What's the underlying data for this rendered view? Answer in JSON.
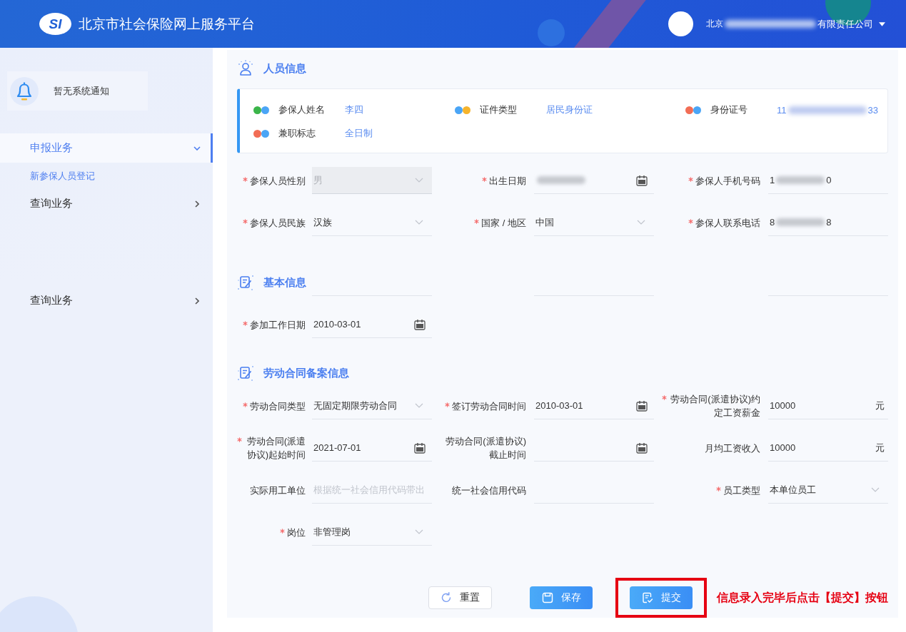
{
  "header": {
    "logo_text": "SI",
    "title": "北京市社会保险网上服务平台",
    "account": {
      "name_start": "北京",
      "name_end": "有限责任公司",
      "redacted": true
    }
  },
  "sidebar": {
    "notice": "暂无系统通知",
    "menu_groups": [
      {
        "items": [
          {
            "label": "申报业务",
            "selected": true,
            "expanded": true,
            "children": [
              {
                "label": "新参保人员登记",
                "selected": true
              }
            ]
          },
          {
            "label": "查询业务",
            "selected": false,
            "expanded": false
          }
        ]
      },
      {
        "items": [
          {
            "label": "查询业务",
            "selected": false,
            "expanded": false
          }
        ]
      }
    ]
  },
  "sections": [
    {
      "kind": "summary",
      "title": "人员信息",
      "summary": [
        {
          "label": "参保人姓名",
          "value": "李四",
          "redacted": false,
          "dots": [
            {
              "color": "#3bb54a"
            },
            {
              "color": "#4aa5f6"
            }
          ]
        },
        {
          "label": "证件类型",
          "value": "居民身份证",
          "redacted": false,
          "dots": [
            {
              "color": "#4aa5f6"
            },
            {
              "color": "#f6b42c"
            }
          ]
        },
        {
          "label": "身份证号",
          "value": "11",
          "value_tail": "33",
          "redacted": true,
          "dots": [
            {
              "color": "#f26d55"
            },
            {
              "color": "#4aa5f6"
            }
          ]
        },
        {
          "label": "兼职标志",
          "value": "全日制",
          "redacted": false,
          "dots": [
            {
              "color": "#f26d55"
            },
            {
              "color": "#4aa5f6"
            }
          ]
        }
      ],
      "fields": [
        {
          "kind": "select",
          "label": "参保人员性别",
          "required": true,
          "value": "男",
          "disabled": true,
          "redacted": false
        },
        {
          "kind": "date",
          "label": "出生日期",
          "required": true,
          "disabled": false,
          "redacted": true
        },
        {
          "kind": "text",
          "label": "参保人手机号码",
          "required": true,
          "value": "1",
          "value_tail": "0",
          "disabled": false,
          "redacted": true
        },
        {
          "kind": "select",
          "label": "参保人员民族",
          "required": true,
          "value": "汉族",
          "disabled": false,
          "redacted": false
        },
        {
          "kind": "select",
          "label": "国家 / 地区",
          "required": true,
          "value": "中国",
          "disabled": false,
          "redacted": false
        },
        {
          "kind": "text",
          "label": "参保人联系电话",
          "required": true,
          "value": "8",
          "value_tail": "8",
          "disabled": false,
          "redacted": true
        }
      ]
    },
    {
      "kind": "form",
      "title": "基本信息",
      "fields": [
        {
          "kind": "text",
          "required": false,
          "disabled": false,
          "redacted": false
        },
        {
          "kind": "text",
          "required": false,
          "disabled": false,
          "redacted": false
        },
        {
          "kind": "text",
          "required": false,
          "disabled": false,
          "redacted": false
        },
        {
          "kind": "date",
          "label": "参加工作日期",
          "required": true,
          "value": "2010-03-01",
          "disabled": false,
          "redacted": false
        }
      ]
    },
    {
      "kind": "form",
      "title": "劳动合同备案信息",
      "fields": [
        {
          "kind": "select",
          "label": "劳动合同类型",
          "required": true,
          "value": "无固定期限劳动合同",
          "disabled": false,
          "redacted": false
        },
        {
          "kind": "date",
          "label": "签订劳动合同时间",
          "required": true,
          "value": "2010-03-01",
          "disabled": false,
          "redacted": false
        },
        {
          "kind": "money",
          "label": "劳动合同(派遣协议)约定工资薪金",
          "required": true,
          "value": "10000",
          "unit": "元",
          "disabled": false,
          "redacted": false
        },
        {
          "kind": "date",
          "label": "劳动合同(派遣协议)起始时间",
          "required": true,
          "value": "2021-07-01",
          "disabled": false,
          "redacted": false
        },
        {
          "kind": "date",
          "label": "劳动合同(派遣协议)截止时间",
          "required": false,
          "disabled": false,
          "redacted": false
        },
        {
          "kind": "money",
          "label": "月均工资收入",
          "required": false,
          "value": "10000",
          "unit": "元",
          "disabled": false,
          "redacted": false
        },
        {
          "kind": "text",
          "label": "实际用工单位",
          "required": false,
          "placeholder": "根据统一社会信用代码带出",
          "disabled": false,
          "redacted": false
        },
        {
          "kind": "text",
          "label": "统一社会信用代码",
          "required": false,
          "disabled": false,
          "redacted": false
        },
        {
          "kind": "select",
          "label": "员工类型",
          "required": true,
          "value": "本单位员工",
          "disabled": false,
          "redacted": false
        },
        {
          "kind": "select",
          "label": "岗位",
          "required": true,
          "value": "非管理岗",
          "disabled": false,
          "redacted": false
        }
      ]
    }
  ],
  "actions": {
    "buttons": [
      {
        "kind": "reset",
        "label": "重置",
        "primary": false,
        "highlighted": false
      },
      {
        "kind": "save",
        "label": "保存",
        "primary": true,
        "highlighted": false
      },
      {
        "kind": "submit",
        "label": "提交",
        "primary": true,
        "highlighted": true
      }
    ],
    "annotation": "信息录入完毕后点击【提交】按钮"
  }
}
